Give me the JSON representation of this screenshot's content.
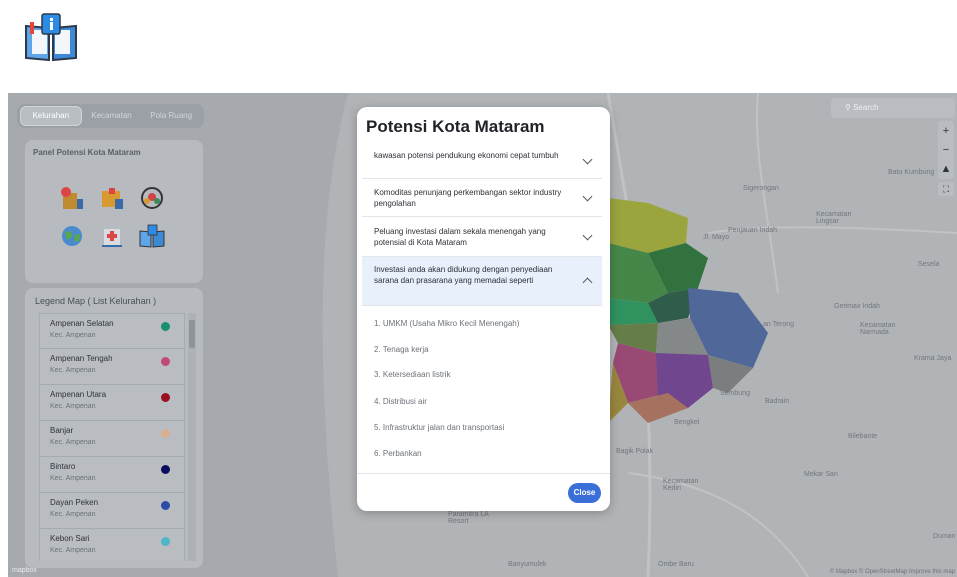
{
  "tabs": [
    "Kelurahan",
    "Kecamatan",
    "Pola Ruang"
  ],
  "panel": {
    "title": "Panel Potensi Kota Mataram"
  },
  "legend": {
    "title": "Legend Map ( List Kelurahan )",
    "items": [
      {
        "name": "Ampenan Selatan",
        "sub": "Kec. Ampenan",
        "color": "#1a8f72"
      },
      {
        "name": "Ampenan Tengah",
        "sub": "Kec. Ampenan",
        "color": "#c2487a"
      },
      {
        "name": "Ampenan Utara",
        "sub": "Kec. Ampenan",
        "color": "#9b1020"
      },
      {
        "name": "Banjar",
        "sub": "Kec. Ampenan",
        "color": "#d9b08f"
      },
      {
        "name": "Bintaro",
        "sub": "Kec. Ampenan",
        "color": "#0c0c5c"
      },
      {
        "name": "Dayan Peken",
        "sub": "Kec. Ampenan",
        "color": "#2c4aa8"
      },
      {
        "name": "Kebon Sari",
        "sub": "Kec. Ampenan",
        "color": "#4fb6c8"
      }
    ]
  },
  "search": {
    "placeholder": "Search"
  },
  "map_labels": {
    "baiKumbung": "Batu Kumbung",
    "sigerongan": "Sigerongan",
    "kecLingsar": "Kecamatan Lingsar",
    "jlMaya": "Jl. Mayo",
    "peninjauan": "Penjauan Indah",
    "sesela": "Sesela",
    "gerimaxIndah": "Gerimax Indah",
    "terong": "an Terong",
    "kecNarmada": "Kecamatan Narmada",
    "kramaJaya": "Krama Jaya",
    "sembung": "Sembung",
    "badrain": "Badrain",
    "bengkel": "Bengkel",
    "bilebante": "Bilebante",
    "bagikPolak": "Bagik Polak",
    "mekarSari": "Mekar Sari",
    "kecKediri": "Kecamatan Kediri",
    "duman": "Duman",
    "laResort": "Paramitra LA Resort",
    "banyumulek": "Banyumulek",
    "ombeBaru": "Ombe Baru",
    "mapbox": "mapbox",
    "attribution": "© Mapbox © OpenStreetMap Improve this map"
  },
  "modal": {
    "title": "Potensi Kota Mataram",
    "accordions": [
      {
        "label": "kawasan potensi pendukung ekonomi cepat tumbuh",
        "open": false
      },
      {
        "label": "Komoditas penunjang perkembangan sektor industry pengolahan",
        "open": false
      },
      {
        "label": "Peluang investasi dalam sekala menengah yang potensial di Kota Mataram",
        "open": false
      },
      {
        "label": "Investasi anda akan didukung dengan penyediaan sarana dan prasarana yang memadai seperti",
        "open": true
      }
    ],
    "items": [
      "1. UMKM (Usaha Mikro Kecil Menengah)",
      "2. Tenaga kerja",
      "3. Ketersediaan listrik",
      "4. Distribusi air",
      "5. Infrastruktur jalan dan transportasi",
      "6. Perbankan"
    ],
    "close_label": "Close"
  }
}
